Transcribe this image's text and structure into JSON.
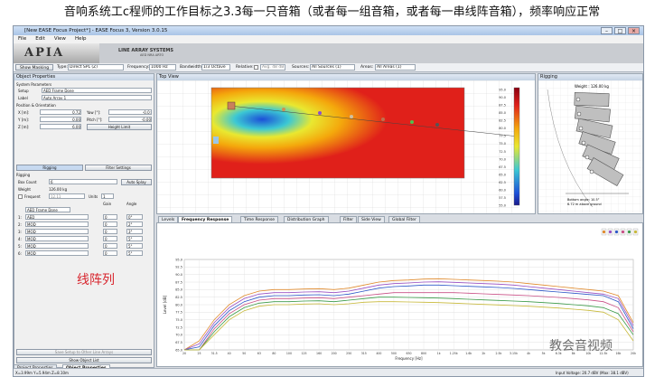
{
  "caption": "音响系统工c程师的工作目标之3.3每一只音箱（或者每一组音箱，或者每一串线阵音箱），频率响应正常",
  "window": {
    "title": "[New EASE Focus Project*] - EASE Focus 3, Version 3.0.15"
  },
  "menu": [
    "File",
    "Edit",
    "View",
    "Help"
  ],
  "banner": {
    "logo": "APIA",
    "subtitle": "LINE ARRAY SYSTEMS",
    "subtitle2": "AED NRA ARTO"
  },
  "toolbar": {
    "show_masking": "Show Masking",
    "type_label": "Type:",
    "type_value": "Direct SPL (Z)",
    "frequency_label": "Frequency:",
    "frequency_value": "1000 Hz",
    "bandwidth_label": "Bandwidth:",
    "bandwidth_value": "1/3 Octave",
    "relative_label": "Relative:",
    "relative_value": "Avg. 48 dB",
    "sources_label": "Sources:",
    "sources_value": "All Sources (1)",
    "areas_label": "Areas:",
    "areas_value": "All Areas (1)"
  },
  "object_properties": {
    "title": "Object Properties",
    "system_parameters": "System Parameters",
    "setup_label": "Setup",
    "setup_value": "AED Frame Done",
    "label_label": "Label",
    "label_value": "Auto Array 1",
    "position_heading": "Position & Orientation",
    "x_label": "X [m]:",
    "x_value": "0.72",
    "y_label": "Y [m]:",
    "y_value": "0.00",
    "z_label": "Z [m]:",
    "z_value": "6.00",
    "yaw_label": "Yaw [°]:",
    "yaw_value": "-0.0:",
    "pitch_label": "Pitch [°]:",
    "pitch_value": "-0.00",
    "roll_label": "Roll [°]:",
    "roll_value": "0.00",
    "height_limit_button": "Height Limit",
    "rigging_tab": "Rigging",
    "filter_settings_tab": "Filter Settings",
    "rigging_heading": "Rigging",
    "box_count_label": "Box Count",
    "box_count_value": "6",
    "auto_splay_button": "Auto Splay",
    "weight_label": "Weight",
    "weight_value": "126.00 kg",
    "frequent_label": "Frequent",
    "frequent_value": "12.11",
    "units_label": "Units",
    "units_value": "1",
    "gain_header": "Gain",
    "angle_header": "Angle",
    "frame_row_label": "AED Frame Done",
    "boxes": [
      {
        "index": "1:",
        "model": "AED",
        "gain": "0",
        "angle": "0°"
      },
      {
        "index": "2:",
        "model": "MOD",
        "gain": "0",
        "angle": "2°"
      },
      {
        "index": "3:",
        "model": "MOD",
        "gain": "0",
        "angle": "3°"
      },
      {
        "index": "4:",
        "model": "MOD",
        "gain": "0",
        "angle": "5°"
      },
      {
        "index": "5:",
        "model": "MOD",
        "gain": "0",
        "angle": "5°"
      },
      {
        "index": "6:",
        "model": "MOD",
        "gain": "0",
        "angle": "5°"
      }
    ],
    "save_setup_button": "Save Setup to Other Line Arrays",
    "show_object_list_button": "Show Object List",
    "bottom_tabs": [
      "Project Properties",
      "Object Properties"
    ]
  },
  "overlay_label": "线阵列",
  "top_view": {
    "title": "Top View",
    "scale_ticks": [
      "95.0",
      "90.0",
      "87.5",
      "85.0",
      "82.5",
      "80.0",
      "77.5",
      "75.0",
      "72.5",
      "70.0",
      "67.5",
      "65.0",
      "62.5",
      "60.0",
      "57.5",
      "55.0"
    ],
    "colors": {
      "hot": "#e0201a",
      "warm": "#f4a80c",
      "mild": "#e9e830",
      "cool": "#3cc8d4",
      "cold": "#1c4fd8"
    }
  },
  "rigging": {
    "title": "Rigging",
    "weight_text": "Weight : 126.00 kg",
    "bottom_angle": "Bottom angle: 10.5°",
    "ground_text": "6.72 m above ground"
  },
  "lower_tabs": [
    "Levels",
    "Frequency Response",
    "Time Response",
    "Distribution Graph",
    "Filter",
    "Side View",
    "Global Filter"
  ],
  "active_lower_tab": "Frequency Response",
  "chart_data": {
    "type": "line",
    "xlabel": "Frequency [Hz]",
    "ylabel": "Level [dB]",
    "ylim": [
      65,
      95
    ],
    "y_ticks": [
      "95.0",
      "92.5",
      "90.0",
      "87.5",
      "85.0",
      "82.5",
      "80.0",
      "77.5",
      "75.0",
      "72.5",
      "70.0",
      "67.5",
      "65.0"
    ],
    "x_ticks": [
      "20",
      "25",
      "31.5",
      "40",
      "50",
      "63",
      "80",
      "100",
      "125",
      "160",
      "200",
      "250",
      "315",
      "400",
      "500",
      "630",
      "800",
      "1k",
      "1.25k",
      "1.6k",
      "2k",
      "2.5k",
      "3.15k",
      "4k",
      "5k",
      "6.3k",
      "8k",
      "10k",
      "12.5k",
      "16k",
      "20k"
    ],
    "series": [
      {
        "color": "#e08a2c",
        "values": [
          65,
          68,
          75,
          80,
          83,
          84.5,
          85,
          85,
          85.2,
          85.3,
          85,
          85.5,
          86.5,
          87.5,
          88,
          88.2,
          88.5,
          88.6,
          88.4,
          88.2,
          88,
          87.8,
          87.5,
          87,
          86.5,
          86,
          85.5,
          85,
          84.5,
          83,
          74
        ]
      },
      {
        "color": "#9a4fc2",
        "values": [
          64,
          67,
          74,
          79,
          82,
          83.5,
          84,
          84,
          84.2,
          84.3,
          84,
          84.5,
          85.5,
          86.5,
          87,
          87.2,
          87.5,
          87.6,
          87.4,
          87.2,
          87,
          86.8,
          86.5,
          86,
          85.5,
          85,
          84.5,
          84,
          83.5,
          82,
          73
        ]
      },
      {
        "color": "#2e58c8",
        "values": [
          63,
          66,
          73,
          78,
          81,
          82.5,
          83,
          83,
          83.2,
          83.3,
          83,
          83.5,
          84.5,
          85.5,
          86,
          86.2,
          86.5,
          86.5,
          86.3,
          86.1,
          85.9,
          85.7,
          85.4,
          85,
          84.6,
          84.2,
          83.8,
          83.4,
          83,
          81,
          72
        ]
      },
      {
        "color": "#c94f86",
        "values": [
          62,
          65,
          72,
          77,
          80,
          81.5,
          82,
          82,
          82.2,
          82.3,
          82,
          82.5,
          83,
          83.5,
          84,
          84,
          84,
          84,
          84,
          83.8,
          83.6,
          83.4,
          83.2,
          83,
          82.7,
          82.4,
          82,
          81.6,
          81,
          79,
          71
        ]
      },
      {
        "color": "#3b9a48",
        "values": [
          61,
          64,
          71,
          76,
          79,
          80.5,
          81,
          81,
          81.2,
          81.3,
          81,
          81.5,
          82,
          82.5,
          82.5,
          82.4,
          82.3,
          82.2,
          82,
          81.8,
          81.6,
          81.4,
          81.2,
          81,
          80.7,
          80.4,
          80,
          79.6,
          79,
          77,
          70
        ]
      },
      {
        "color": "#c8b93a",
        "values": [
          60,
          63,
          70,
          75,
          78,
          79.5,
          80,
          80,
          80.2,
          80.3,
          80,
          80.3,
          80.8,
          81,
          81,
          80.9,
          80.8,
          80.7,
          80.5,
          80.3,
          80.1,
          79.9,
          79.7,
          79.5,
          79.2,
          78.9,
          78.5,
          78.1,
          77.5,
          75,
          68
        ]
      }
    ]
  },
  "status": {
    "coords": "X=3.99m Y=5.94m Z=8.10m",
    "voltage": "Input Voltage: 20.7 dBV (Max: 38.1 dBV)"
  },
  "watermark": "教会音视频"
}
